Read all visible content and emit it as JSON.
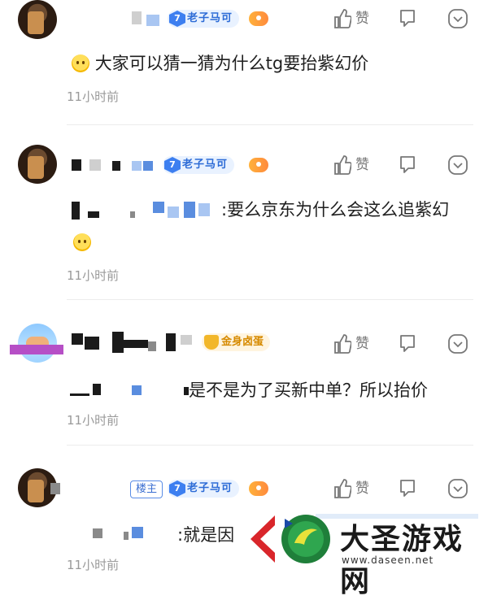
{
  "comments": [
    {
      "badge_level": "7",
      "badge_text": "老子马可",
      "like_label": "赞",
      "text": "大家可以猜一猜为什么tg要抬紫幻价",
      "time": "11小时前"
    },
    {
      "badge_level": "7",
      "badge_text": "老子马可",
      "like_label": "赞",
      "text": ":要么京东为什么会这么追紫幻",
      "time": "11小时前"
    },
    {
      "badge_text": "金身卤蛋",
      "like_label": "赞",
      "text": "是不是为了买新中单？所以抬价",
      "time": "11小时前"
    },
    {
      "host_tag": "楼主",
      "badge_level": "7",
      "badge_text": "老子马可",
      "like_label": "赞",
      "text": ":就是因",
      "time": "11小时前"
    }
  ],
  "watermark": {
    "title": "大圣游戏网",
    "url": "www.daseen.net"
  },
  "icons": {
    "like": "thumbs-up-icon",
    "reply": "comment-icon",
    "more": "more-icon",
    "emoji": "smile-emoji-icon",
    "game": "gamepad-icon"
  },
  "colors": {
    "accent": "#2c6bd6",
    "badge_bg": "#e9f2ff",
    "gold": "#d68a00",
    "muted": "#9a9a9a"
  }
}
